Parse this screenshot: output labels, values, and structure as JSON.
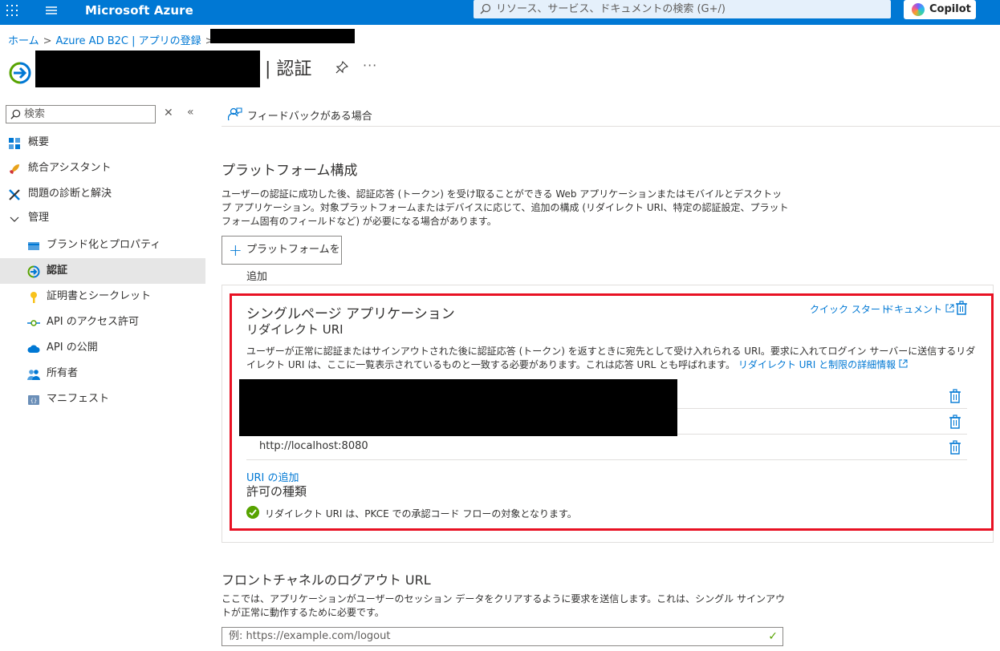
{
  "topbar": {
    "brand": "Microsoft Azure",
    "search_placeholder": "リソース、サービス、ドキュメントの検索 (G+/)",
    "copilot_label": "Copilot",
    "colors": {
      "bar": "#0078d4",
      "search_bg": "#e5f0fb"
    }
  },
  "breadcrumb": {
    "items": [
      "ホーム",
      "Azure AD B2C | アプリの登録"
    ]
  },
  "header": {
    "title": "| 認証",
    "more": "···"
  },
  "sidebar": {
    "search_placeholder": "検索",
    "items": [
      {
        "label": "概要",
        "icon": "overview-grid-icon"
      },
      {
        "label": "統合アシスタント",
        "icon": "rocket-icon"
      },
      {
        "label": "問題の診断と解決",
        "icon": "wrench-icon"
      },
      {
        "label": "管理",
        "icon": "chevron-down-icon"
      },
      {
        "label": "ブランド化とプロパティ",
        "icon": "branding-card-icon"
      },
      {
        "label": "認証",
        "icon": "authentication-arrow-icon",
        "active": true
      },
      {
        "label": "証明書とシークレット",
        "icon": "key-icon"
      },
      {
        "label": "API のアクセス許可",
        "icon": "api-permission-icon"
      },
      {
        "label": "API の公開",
        "icon": "cloud-icon"
      },
      {
        "label": "所有者",
        "icon": "people-icon"
      },
      {
        "label": "マニフェスト",
        "icon": "manifest-icon"
      }
    ]
  },
  "commandbar": {
    "feedback_label": "フィードバックがある場合"
  },
  "platform": {
    "heading": "プラットフォーム構成",
    "description": "ユーザーの認証に成功した後、認証応答 (トークン) を受け取ることができる Web アプリケーションまたはモバイルとデスクトップ アプリケーション。対象プラットフォームまたはデバイスに応じて、追加の構成 (リダイレクト URI、特定の認証設定、プラットフォーム固有のフィールドなど) が必要になる場合があります。",
    "add_button": "プラットフォームを追加"
  },
  "spa": {
    "title": "シングルページ アプリケーション",
    "subtitle": "リダイレクト URI",
    "quickstart": "クイック スタート",
    "docs": "ドキュメント",
    "description": "ユーザーが正常に認証またはサインアウトされた後に認証応答 (トークン) を返すときに宛先として受け入れられる URI。要求に入れてログイン サーバーに送信するリダイレクト URI は、ここに一覧表示されているものと一致する必要があります。これは応答 URL とも呼ばれます。",
    "learn_more": "リダイレクト URI と制限の詳細情報",
    "uris": [
      "http://localhost:8080"
    ],
    "add_uri": "URI の追加",
    "grant_heading": "許可の種類",
    "grant_text": "リダイレクト URI は、PKCE での承認コード フローの対象となります。",
    "colors": {
      "highlight": "#e81123",
      "success": "#57a300"
    }
  },
  "logout": {
    "heading": "フロントチャネルのログアウト URL",
    "description": "ここでは、アプリケーションがユーザーのセッション データをクリアするように要求を送信します。これは、シングル サインアウトが正常に動作するために必要です。",
    "placeholder": "例: https://example.com/logout"
  }
}
